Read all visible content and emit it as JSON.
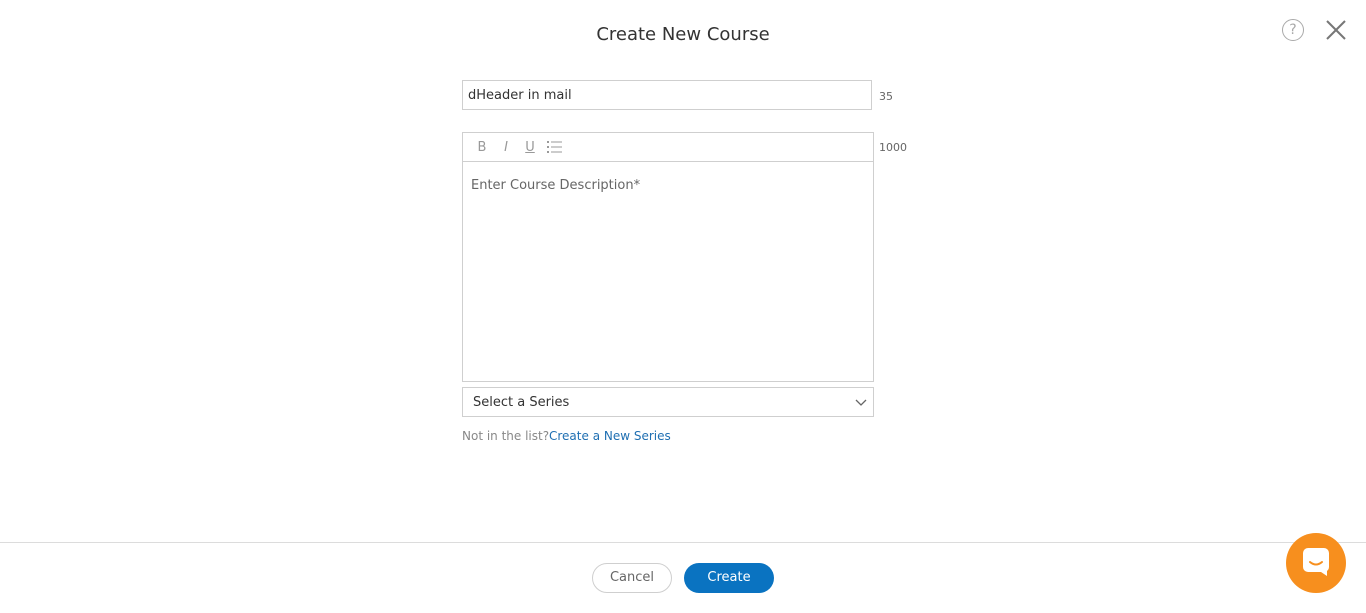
{
  "dialog": {
    "title": "Create New Course"
  },
  "header": {
    "help_icon_label": "?",
    "help_icon": "question-circle-icon",
    "close_icon": "close-x-icon"
  },
  "form": {
    "name_value": "dHeader in mail",
    "name_counter": "35",
    "description_counter": "1000",
    "description_placeholder": "Enter Course Description*",
    "toolbar": {
      "bold": "B",
      "italic": "I",
      "underline": "U",
      "list_icon": "bulleted-list-icon"
    },
    "series_selected": "Select a Series",
    "not_in_list": "Not in the list?",
    "create_series_link": "Create a New Series"
  },
  "footer": {
    "cancel_label": "Cancel",
    "create_label": "Create"
  },
  "chat": {
    "icon": "chat-bubble-icon"
  },
  "colors": {
    "primary": "#0a73c1",
    "link": "#1f6fb2",
    "chat": "#f78f1e"
  }
}
